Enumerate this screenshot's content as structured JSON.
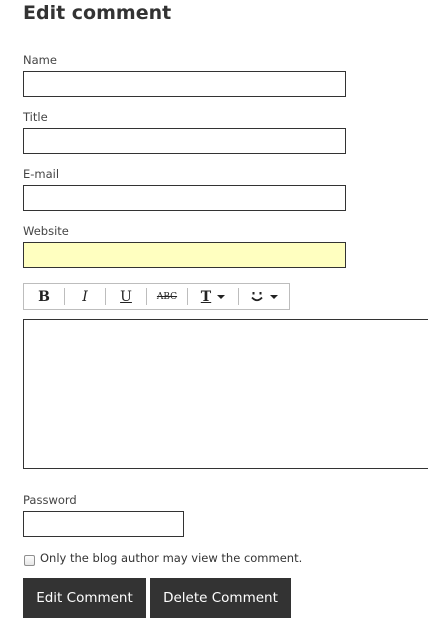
{
  "heading": "Edit comment",
  "form": {
    "name": {
      "label": "Name",
      "value": ""
    },
    "title": {
      "label": "Title",
      "value": ""
    },
    "email": {
      "label": "E-mail",
      "value": ""
    },
    "website": {
      "label": "Website",
      "value": ""
    },
    "password": {
      "label": "Password",
      "value": ""
    }
  },
  "toolbar": {
    "bold": "B",
    "italic": "I",
    "underline": "U",
    "strikethrough": "ABC",
    "text_style": "T",
    "emoji_icon": "smiley-icon"
  },
  "editor": {
    "value": ""
  },
  "private_checkbox": {
    "label": "Only the blog author may view the comment.",
    "checked": false
  },
  "buttons": {
    "edit": "Edit Comment",
    "delete": "Delete Comment"
  },
  "colors": {
    "highlight_field": "#ffffc0",
    "button_bg": "#333333",
    "button_text": "#ffffff"
  }
}
